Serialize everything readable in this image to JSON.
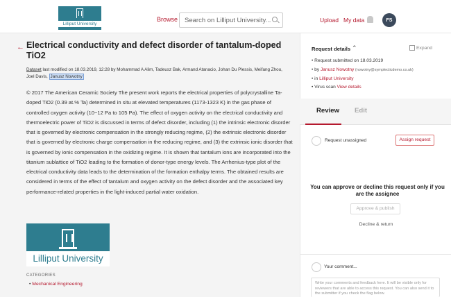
{
  "header": {
    "logo_text": "Lilliput University",
    "browse_label": "Browse",
    "search_placeholder": "Search on Lilliput University...",
    "upload_label": "Upload",
    "mydata_label": "My data",
    "avatar_initials": "FS"
  },
  "dataset": {
    "title": "Electrical conductivity and defect disorder of tantalum-doped TiO2",
    "meta_dataset": "Dataset",
    "meta_text": " last modified on 18.03.2019, 12:28 by Mohammad A Alim, Tadeusz Bak, Armand Atanacio, Johan Du Plessis, Meifang Zhou, Joel Davis, ",
    "meta_highlight": "Janusz Nowotny",
    "description": "© 2017 The American Ceramic Society The present work reports the electrical properties of polycrystalline Ta-doped TiO2 (0.39 at.% Ta) determined in situ at elevated temperatures (1173-1323 K) in the gas phase of controlled oxygen activity (10−12 Pa to 105 Pa). The effect of oxygen activity on the electrical conductivity and thermoelectric power of TiO2 is discussed in terms of defect disorder, including (1) the intrinsic electronic disorder that is governed by electronic compensation in the strongly reducing regime, (2) the extrinsic electronic disorder that is governed by electronic charge compensation in the reducing regime, and (3) the extrinsic ionic disorder that is governed by ionic compensation in the oxidizing regime. It is shown that tantalum ions are incorporated into the titanium sublattice of TiO2 leading to the formation of donor-type energy levels. The Arrhenius-type plot of the electrical conductivity data leads to the determination of the formation enthalpy terms. The obtained results are considered in terms of the effect of tantalum and oxygen activity on the defect disorder and the associated key performance-related properties in the light-induced partial water oxidation.",
    "logo_text": "Lilliput University",
    "categories_label": "CATEGORIES",
    "category": "Mechanical Engineering"
  },
  "request": {
    "title": "Request details",
    "expand_label": "Expand",
    "submitted": "Request submitted on 18.03.2019",
    "by_prefix": "by ",
    "by_name": "Janusz Nowotny",
    "by_email": " (nowotny@symplecticdemo.co.uk)",
    "in_prefix": "in ",
    "in_org": "Lilliput University",
    "virus_prefix": "Virus scan ",
    "virus_link": "View details"
  },
  "review": {
    "tab_review": "Review",
    "tab_edit": "Edit",
    "unassigned": "Request unassigned",
    "assign_label": "Assign request",
    "approve_message": "You can approve or decline this request only if you are the assignee",
    "approve_label": "Approve & publish",
    "decline_label": "Decline & return",
    "comment_label": "Your comment...",
    "comment_placeholder": "Write your comments and feedback here. It will be visible only for reviewers that are able to access this request. You can also send it to the submitter if you check the flag below."
  },
  "colors": {
    "accent": "#b5192e",
    "brand": "#2e7d8f"
  }
}
